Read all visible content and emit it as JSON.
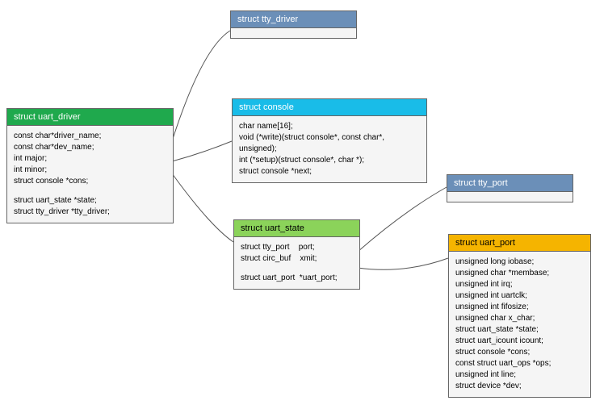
{
  "boxes": {
    "uart_driver": {
      "title": "struct uart_driver",
      "fields": [
        "const char*driver_name;",
        "const char*dev_name;",
        "int major;",
        "int minor;",
        "struct console *cons;",
        "",
        "struct uart_state *state;",
        "struct tty_driver *tty_driver;"
      ]
    },
    "tty_driver": {
      "title": "struct tty_driver"
    },
    "console": {
      "title": "struct console",
      "fields": [
        "char name[16];",
        "void (*write)(struct console*, const char*,",
        "unsigned);",
        "int (*setup)(struct console*, char *);",
        "struct console *next;"
      ]
    },
    "uart_state": {
      "title": "struct uart_state",
      "fields": [
        "struct tty_port    port;",
        "struct circ_buf    xmit;",
        "",
        "struct uart_port  *uart_port;"
      ]
    },
    "tty_port": {
      "title": "struct tty_port"
    },
    "uart_port": {
      "title": "struct uart_port",
      "fields": [
        "unsigned long iobase;",
        "unsigned char *membase;",
        "unsigned int irq;",
        "unsigned int uartclk;",
        "unsigned int fifosize;",
        "unsigned char x_char;",
        "struct uart_state *state;",
        "struct uart_icount icount;",
        "struct console *cons;",
        "const struct uart_ops *ops;",
        "unsigned int line;",
        "struct device *dev;"
      ]
    }
  },
  "colors": {
    "green_header": "#1fa94d",
    "cyan_header": "#19bce8",
    "lightgreen_header": "#8bd35a",
    "blue_header": "#6b8fb8",
    "orange_header": "#f5b400"
  }
}
